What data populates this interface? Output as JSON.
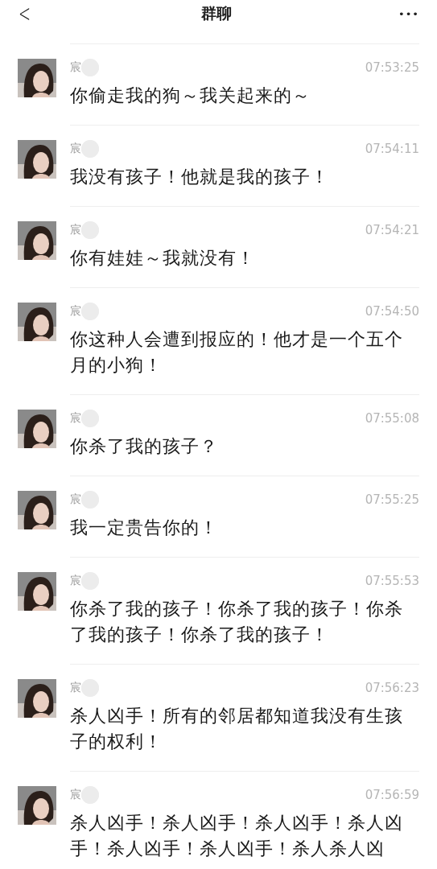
{
  "header": {
    "back": "<",
    "title": "群聊",
    "more": "•••"
  },
  "messages": [
    {
      "sender": "宸",
      "time": "07:53:25",
      "text": "你偷走我的狗～我关起来的～"
    },
    {
      "sender": "宸",
      "time": "07:54:11",
      "text": "我没有孩子！他就是我的孩子！"
    },
    {
      "sender": "宸",
      "time": "07:54:21",
      "text": "你有娃娃～我就没有！"
    },
    {
      "sender": "宸",
      "time": "07:54:50",
      "text": "你这种人会遭到报应的！他才是一个五个月的小狗！"
    },
    {
      "sender": "宸",
      "time": "07:55:08",
      "text": "你杀了我的孩子？"
    },
    {
      "sender": "宸",
      "time": "07:55:25",
      "text": "我一定贵告你的！"
    },
    {
      "sender": "宸",
      "time": "07:55:53",
      "text": "你杀了我的孩子！你杀了我的孩子！你杀了我的孩子！你杀了我的孩子！"
    },
    {
      "sender": "宸",
      "time": "07:56:23",
      "text": "杀人凶手！所有的邻居都知道我没有生孩子的权利！"
    },
    {
      "sender": "宸",
      "time": "07:56:59",
      "text": "杀人凶手！杀人凶手！杀人凶手！杀人凶手！杀人凶手！杀人凶手！杀人杀人凶"
    }
  ]
}
